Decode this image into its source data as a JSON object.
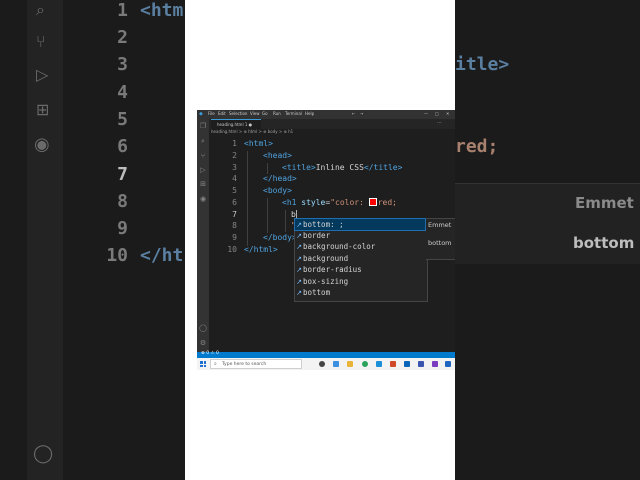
{
  "background_left": {
    "line_numbers": [
      "1",
      "2",
      "3",
      "4",
      "5",
      "6",
      "7",
      "8",
      "9",
      "10"
    ],
    "code_fragments": {
      "line1": "<htm",
      "line10": "</ht"
    }
  },
  "background_right": {
    "code_fragments": {
      "line3": "itle>",
      "line6": "red;"
    },
    "suggest_labels": [
      "Emmet",
      "bottom"
    ]
  },
  "titlebar": {
    "menus": [
      "File",
      "Edit",
      "Selection",
      "View",
      "Go",
      "Run",
      "Terminal",
      "Help"
    ]
  },
  "tab": {
    "label": "heading.html 1 ●"
  },
  "breadcrumb": {
    "text": "heading.html > ⊕ html > ⊕ body > ⊕ h1"
  },
  "editor": {
    "line_numbers": [
      "1",
      "2",
      "3",
      "4",
      "5",
      "6",
      "7",
      "8",
      "9",
      "10"
    ],
    "lines": {
      "l1_open": "<html>",
      "l2_open": "<head>",
      "l3_open": "<title>",
      "l3_text": "Inline CSS",
      "l3_close": "</title>",
      "l4_close": "</head>",
      "l5_open": "<body>",
      "l6_tag": "<h1",
      "l6_attr": "style",
      "l6_eq": "=",
      "l6_str_a": "\"color: ",
      "l6_str_b": "red;",
      "l7_text": "b",
      "l8_a": "\">",
      "l8_b": "H",
      "l9_close": "</body>",
      "l10_close": "</html>"
    }
  },
  "suggestions": {
    "items": [
      "bottom: ;",
      "border",
      "background-color",
      "background",
      "border-radius",
      "box-sizing",
      "bottom"
    ],
    "selected_index": 0,
    "detail_labels": [
      "Emmet",
      "bottom"
    ]
  },
  "statusbar": {
    "text": "⊗ 0 ⚠ 0"
  },
  "taskbar": {
    "search_placeholder": "Type here to search"
  },
  "colors": {
    "accent": "#007acc",
    "selection": "#04395e",
    "editor_bg": "#1e1e1e",
    "swatch": "#ff0000"
  }
}
